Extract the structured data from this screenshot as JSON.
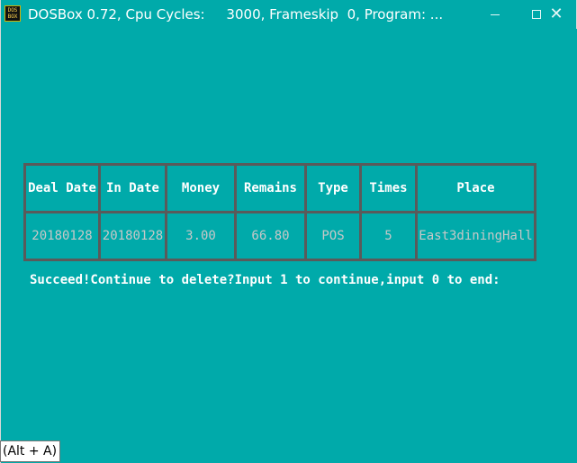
{
  "window": {
    "title": "DOSBox 0.72, Cpu Cycles:     3000, Frameskip  0, Program: ...",
    "icon_name": "dosbox-icon",
    "icon_text_top": "DOS",
    "icon_text_bottom": "BOX",
    "controls": {
      "minimize": "minimize-icon",
      "maximize": "maximize-icon",
      "close": "close-icon",
      "close_glyph": "✕"
    },
    "background_color": "#00aaaa"
  },
  "table": {
    "headers": [
      "Deal Date",
      "In Date",
      "Money",
      "Remains",
      "Type",
      "Times",
      "Place"
    ],
    "rows": [
      [
        "20180128",
        "20180128",
        "3.00",
        "66.80",
        "POS",
        "5",
        "East3diningHall"
      ]
    ],
    "border_color": "#5a5a5a",
    "header_color": "#ffffff",
    "value_color": "#c8c8c8"
  },
  "prompt": "Succeed!Continue to delete?Input 1 to continue,input 0 to end:",
  "tooltip": "(Alt + A)"
}
